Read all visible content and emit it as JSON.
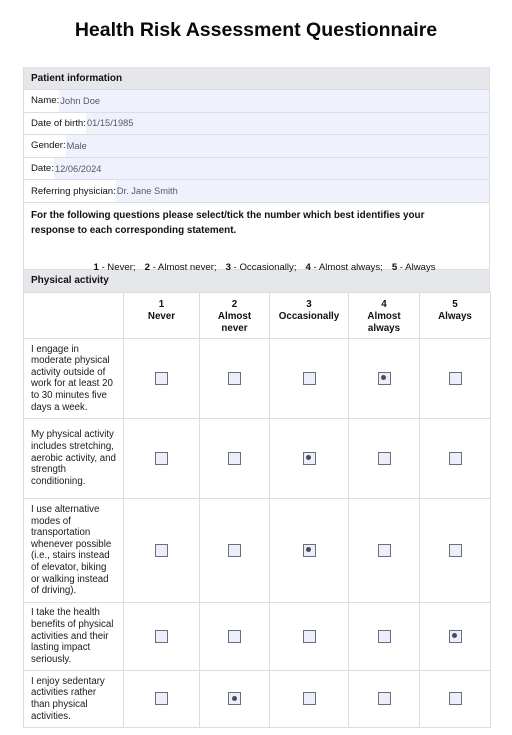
{
  "title": "Health Risk Assessment Questionnaire",
  "patient_info": {
    "heading": "Patient information",
    "fields": [
      {
        "label": "Name:",
        "value": "John Doe"
      },
      {
        "label": "Date of birth:",
        "value": "01/15/1985"
      },
      {
        "label": "Gender:",
        "value": "Male"
      },
      {
        "label": "Date:",
        "value": "12/06/2024"
      },
      {
        "label": "Referring physician:",
        "value": "Dr. Jane Smith"
      }
    ]
  },
  "instructions": {
    "text": "For the following questions please select/tick the number which best identifies your response to each corresponding statement.",
    "scale": [
      {
        "num": "1",
        "label": " - Never;"
      },
      {
        "num": "2",
        "label": " - Almost never;"
      },
      {
        "num": "3",
        "label": " - Occasionally;"
      },
      {
        "num": "4",
        "label": " - Almost always;"
      },
      {
        "num": "5",
        "label": " - Always"
      }
    ]
  },
  "physical_activity": {
    "heading": "Physical activity",
    "columns": [
      {
        "num": "1",
        "label": "Never"
      },
      {
        "num": "2",
        "label": "Almost never"
      },
      {
        "num": "3",
        "label": "Occasionally"
      },
      {
        "num": "4",
        "label": "Almost always"
      },
      {
        "num": "5",
        "label": "Always"
      }
    ],
    "questions": [
      {
        "text": "I engage in moderate physical activity outside of work for at least 20 to 30 minutes five days a week.",
        "selected": 4
      },
      {
        "text": "My physical activity includes stretching, aerobic activity, and strength conditioning.",
        "selected": 3
      },
      {
        "text": "I use alternative modes of transportation whenever possible (i.e., stairs instead of elevator, biking or walking instead of driving).",
        "selected": 3
      },
      {
        "text": "I take the health benefits of physical activities and their lasting impact seriously.",
        "selected": 5
      },
      {
        "text": "I enjoy sedentary activities rather than physical activities.",
        "selected": 2
      }
    ]
  }
}
